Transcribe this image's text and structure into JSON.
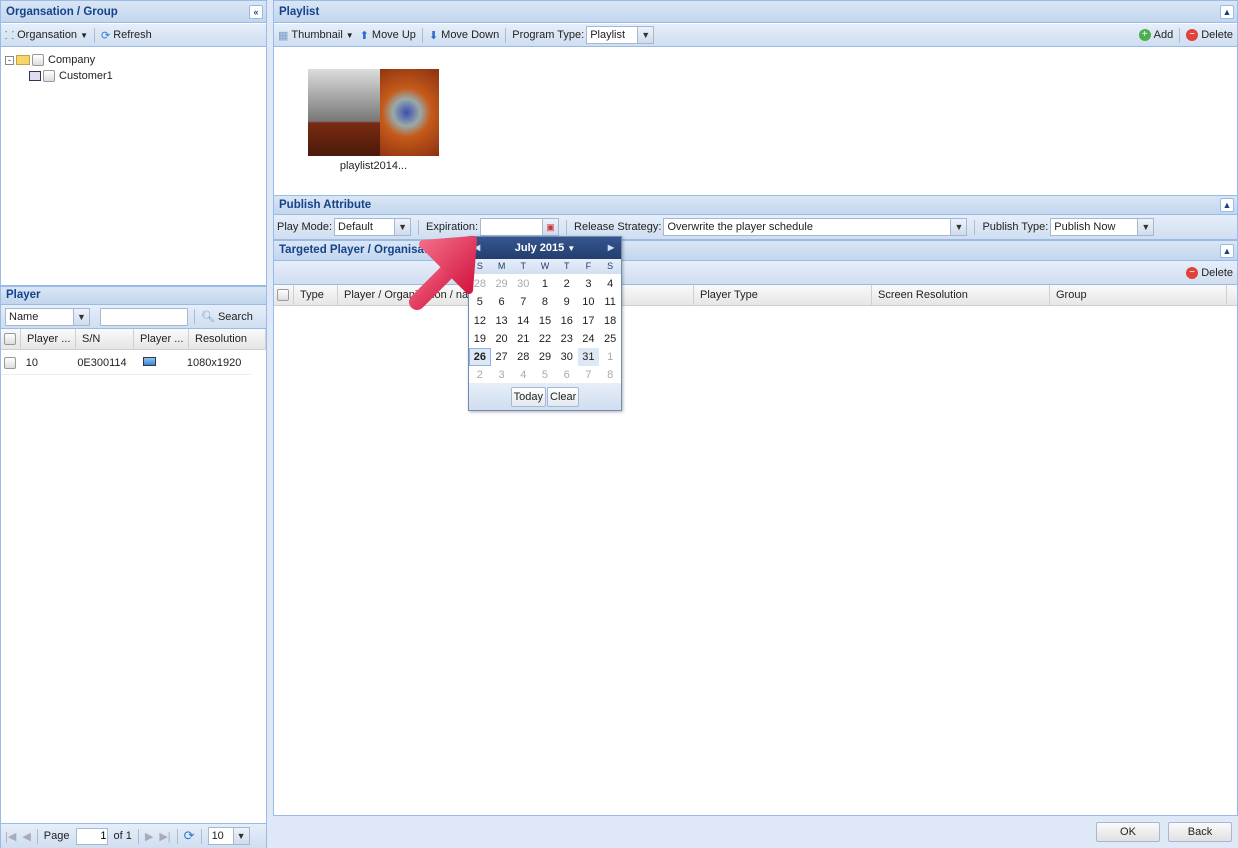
{
  "org_panel": {
    "title": "Organsation / Group",
    "organisation_label": "Organsation",
    "refresh_label": "Refresh",
    "tree": [
      {
        "label": "Company"
      },
      {
        "label": "Customer1"
      }
    ]
  },
  "player_panel": {
    "title": "Player",
    "filter_field": "Name",
    "search_value": "",
    "search_label": "Search",
    "columns": [
      "Player ...",
      "S/N",
      "Player ...",
      "Resolution"
    ],
    "rows": [
      {
        "player": "10",
        "sn": "0E300114",
        "type_icon": "monitor-icon",
        "resolution": "1080x1920"
      }
    ],
    "paging": {
      "page_label": "Page",
      "page": "1",
      "of_label": "of 1",
      "page_size": "10"
    }
  },
  "playlist_panel": {
    "title": "Playlist",
    "thumbnail_label": "Thumbnail",
    "move_up_label": "Move Up",
    "move_down_label": "Move Down",
    "program_type_label": "Program Type:",
    "program_type": "Playlist",
    "add_label": "Add",
    "delete_label": "Delete",
    "items": [
      {
        "name": "playlist2014..."
      }
    ]
  },
  "publish_panel": {
    "title": "Publish Attribute",
    "play_mode_label": "Play Mode:",
    "play_mode": "Default",
    "expiration_label": "Expiration:",
    "expiration": "",
    "release_label": "Release Strategy:",
    "release_strategy": "Overwrite the player schedule",
    "publish_type_label": "Publish Type:",
    "publish_type": "Publish Now"
  },
  "targeted_panel": {
    "title": "Targeted Player / Organisation",
    "delete_label": "Delete",
    "columns": [
      "Type",
      "Player / Organisation / name",
      "Player Type",
      "Screen Resolution",
      "Group"
    ]
  },
  "calendar": {
    "month_label": "July 2015",
    "day_names": [
      "S",
      "M",
      "T",
      "W",
      "T",
      "F",
      "S"
    ],
    "weeks": [
      [
        "28",
        "29",
        "30",
        "1",
        "2",
        "3",
        "4"
      ],
      [
        "5",
        "6",
        "7",
        "8",
        "9",
        "10",
        "11"
      ],
      [
        "12",
        "13",
        "14",
        "15",
        "16",
        "17",
        "18"
      ],
      [
        "19",
        "20",
        "21",
        "22",
        "23",
        "24",
        "25"
      ],
      [
        "26",
        "27",
        "28",
        "29",
        "30",
        "31",
        "1"
      ],
      [
        "2",
        "3",
        "4",
        "5",
        "6",
        "7",
        "8"
      ]
    ],
    "today": "26",
    "selected": "31",
    "today_label": "Today",
    "clear_label": "Clear"
  },
  "footer": {
    "ok_label": "OK",
    "back_label": "Back"
  },
  "colors": {
    "header_text": "#15428b",
    "arrow": "#e8315a",
    "calendar_header": "#233d6e"
  }
}
